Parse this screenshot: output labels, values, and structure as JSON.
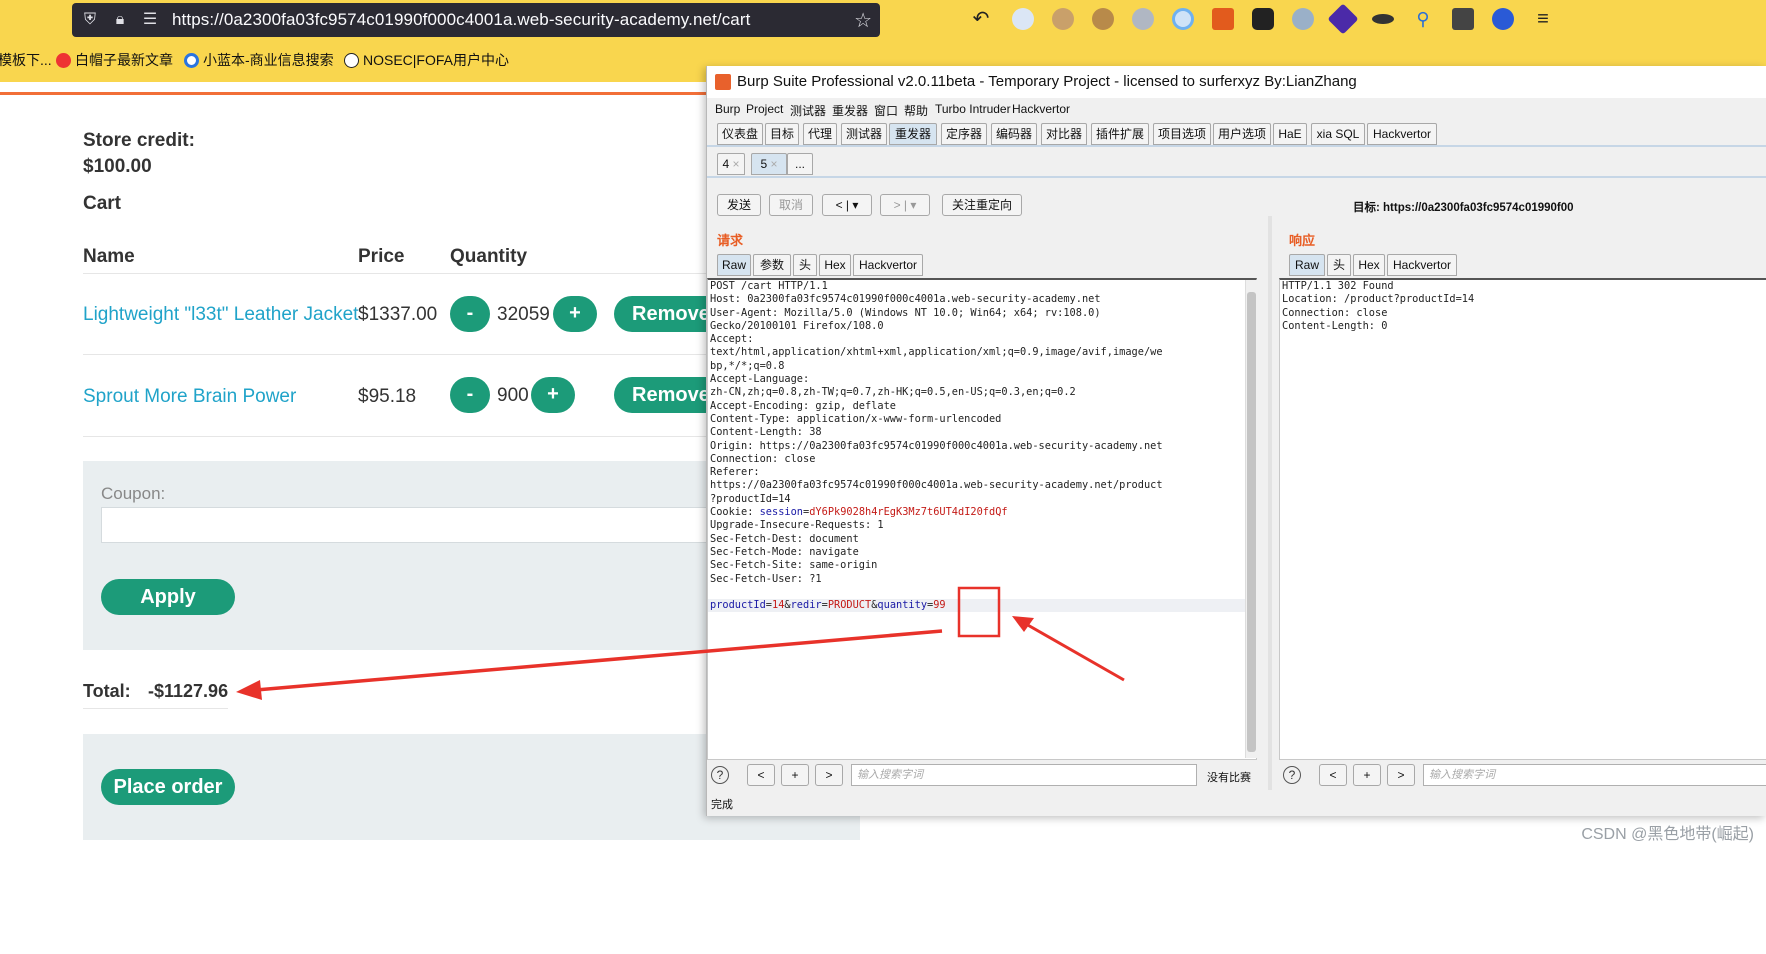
{
  "browser": {
    "url": "https://0a2300fa03fc9574c01990f000c4001a.web-security-academy.net/cart",
    "bookmarks": [
      "模板下...",
      "白帽子最新文章",
      "小蓝本-商业信息搜索",
      "NOSEC|FOFA用户中心"
    ]
  },
  "shop": {
    "store_credit_label": "Store credit:",
    "store_credit_value": "$100.00",
    "cart_heading": "Cart",
    "columns": [
      "Name",
      "Price",
      "Quantity"
    ],
    "items": [
      {
        "name": "Lightweight \"l33t\" Leather Jacket",
        "price": "$1337.00",
        "quantity": "32059",
        "minus": "-",
        "plus": "+",
        "remove": "Remove"
      },
      {
        "name": "Sprout More Brain Power",
        "price": "$95.18",
        "quantity": "900",
        "minus": "-",
        "plus": "+",
        "remove": "Remove"
      }
    ],
    "coupon_label": "Coupon:",
    "coupon_value": "",
    "apply_label": "Apply",
    "total_label": "Total:",
    "total_value": "-$1127.96",
    "place_order_label": "Place order"
  },
  "burp": {
    "title": "Burp Suite Professional v2.0.11beta - Temporary Project - licensed to surferxyz By:LianZhang",
    "menu": [
      "Burp",
      "Project",
      "测试器",
      "重发器",
      "窗口",
      "帮助",
      "Turbo Intruder",
      "Hackvertor"
    ],
    "tools": [
      "仪表盘",
      "目标",
      "代理",
      "测试器",
      "重发器",
      "定序器",
      "编码器",
      "对比器",
      "插件扩展",
      "项目选项",
      "用户选项",
      "HaE",
      "xia SQL",
      "Hackvertor"
    ],
    "active_tool": "重发器",
    "repeater_tabs": [
      "4",
      "5",
      "..."
    ],
    "tab_close": "×",
    "send_label": "发送",
    "cancel_label": "取消",
    "back_label": "<",
    "fwd_label": ">",
    "dropdown_label": "▾",
    "follow_label": "关注重定向",
    "target": "目标: https://0a2300fa03fc9574c01990f00",
    "request_label": "请求",
    "response_label": "响应",
    "request_tabs": [
      "Raw",
      "参数",
      "头",
      "Hex",
      "Hackvertor"
    ],
    "response_tabs": [
      "Raw",
      "头",
      "Hex",
      "Hackvertor"
    ],
    "request_lines": [
      "POST /cart HTTP/1.1",
      "Host: 0a2300fa03fc9574c01990f000c4001a.web-security-academy.net",
      "User-Agent: Mozilla/5.0 (Windows NT 10.0; Win64; x64; rv:108.0)",
      "Gecko/20100101 Firefox/108.0",
      "Accept:",
      "text/html,application/xhtml+xml,application/xml;q=0.9,image/avif,image/we",
      "bp,*/*;q=0.8",
      "Accept-Language:",
      "zh-CN,zh;q=0.8,zh-TW;q=0.7,zh-HK;q=0.5,en-US;q=0.3,en;q=0.2",
      "Accept-Encoding: gzip, deflate",
      "Content-Type: application/x-www-form-urlencoded",
      "Content-Length: 38",
      "Origin: https://0a2300fa03fc9574c01990f000c4001a.web-security-academy.net",
      "Connection: close",
      "Referer:",
      "https://0a2300fa03fc9574c01990f000c4001a.web-security-academy.net/product",
      "?productId=14"
    ],
    "cookie": {
      "prefix": "Cookie: ",
      "name": "session",
      "eq": "=",
      "value": "dY6Pk9028h4rEgK3Mz7t6UT4dI20fdQf"
    },
    "request_lines_2": [
      "Upgrade-Insecure-Requests: 1",
      "Sec-Fetch-Dest: document",
      "Sec-Fetch-Mode: navigate",
      "Sec-Fetch-Site: same-origin",
      "Sec-Fetch-User: ?1"
    ],
    "body": {
      "k1": "productId",
      "eq1": "=",
      "v1": "14",
      "amp1": "&",
      "k2": "redir",
      "eq2": "=",
      "v2": "PRODUCT",
      "amp2": "&",
      "k3": "quantity",
      "eq3": "=",
      "v3": "99"
    },
    "response_lines": [
      "HTTP/1.1 302 Found",
      "Location: /product?productId=14",
      "Connection: close",
      "Content-Length: 0"
    ],
    "search_placeholder": "输入搜索字词",
    "help": "?",
    "prev": "<",
    "plus": "+",
    "next": ">",
    "no_match": "没有比赛",
    "status": "完成"
  },
  "watermark": "CSDN @黑色地带(崛起)",
  "colors": {
    "accent": "#1c9b79",
    "link": "#20a3c9",
    "annotation": "#e8322a",
    "burp_orange": "#e85d24"
  }
}
